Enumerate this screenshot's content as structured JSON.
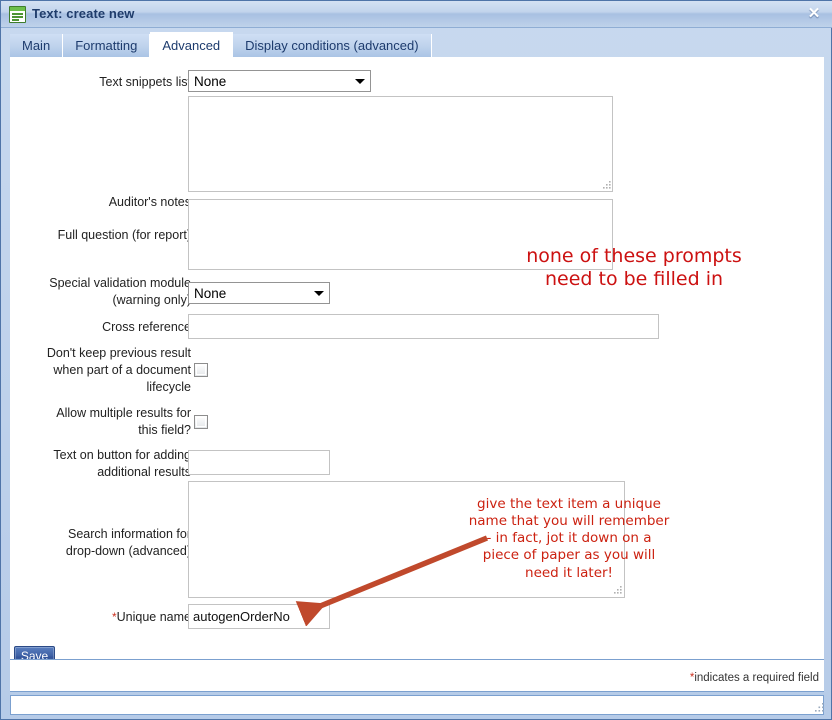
{
  "window": {
    "title": "Text: create new",
    "icon": "form-window-icon",
    "close_label": "✕"
  },
  "tabs": [
    {
      "label": "Main",
      "active": false
    },
    {
      "label": "Formatting",
      "active": false
    },
    {
      "label": "Advanced",
      "active": true
    },
    {
      "label": "Display conditions (advanced)",
      "active": false
    }
  ],
  "form": {
    "text_snippets_list": {
      "label": "Text snippets list",
      "value": "None",
      "options": [
        "None"
      ]
    },
    "auditors_notes": {
      "label": "Auditor's notes",
      "value": "",
      "placeholder": ""
    },
    "full_question": {
      "label": "Full question (for report)",
      "value": "",
      "placeholder": ""
    },
    "special_validation_module": {
      "label_line1": "Special validation module",
      "label_line2": "(warning only)",
      "value": "None",
      "options": [
        "None"
      ]
    },
    "cross_reference": {
      "label": "Cross reference",
      "value": "",
      "placeholder": ""
    },
    "dont_keep_previous_result": {
      "label_line1": "Don't keep previous result",
      "label_line2": "when part of a document",
      "label_line3": "lifecycle",
      "checked": false
    },
    "allow_multiple_results": {
      "label_line1": "Allow multiple results for",
      "label_line2": "this field?",
      "checked": false
    },
    "text_on_button": {
      "label_line1": "Text on button for adding",
      "label_line2": "additional results",
      "value": "",
      "placeholder": ""
    },
    "search_information": {
      "label_line1": "Search information for",
      "label_line2": "drop-down (advanced)",
      "value": "",
      "placeholder": ""
    },
    "unique_name": {
      "label": "Unique name",
      "required_marker": "*",
      "value": "autogenOrderNo",
      "placeholder": ""
    }
  },
  "footer": {
    "save_label": "Save",
    "required_note_marker": "*",
    "required_note_text": "indicates a required field"
  },
  "annotations": {
    "top": "none of these prompts\nneed to be filled in",
    "bottom": "give the text item a unique\nname that you will remember\n- in fact, jot it down on a\npiece of paper as you will\nneed it later!",
    "arrow_color": "#c0492c"
  },
  "colors": {
    "annotation_red": "#cc1111",
    "titlebar_text": "#1f3c6b",
    "active_tab_bg": "#ffffff",
    "tab_bg": "#bed2ec",
    "save_button_bg": "#3d60a4",
    "required_star": "#cc3322"
  }
}
